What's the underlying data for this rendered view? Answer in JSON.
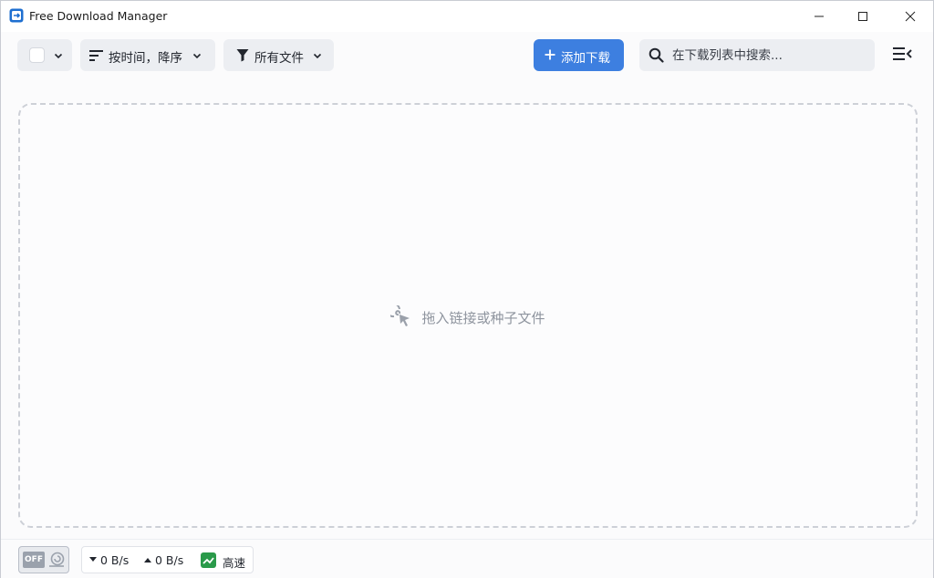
{
  "window": {
    "title": "Free Download Manager"
  },
  "toolbar": {
    "sort_label": "按时间，降序",
    "filter_label": "所有文件",
    "add_download_label": "添加下载",
    "search_placeholder": "在下载列表中搜索..."
  },
  "dropzone": {
    "hint": "拖入链接或种子文件"
  },
  "statusbar": {
    "turbo_state": "OFF",
    "download_speed": "0 B/s",
    "upload_speed": "0 B/s",
    "speed_mode": "高速"
  },
  "icons": {
    "app": "fdm-app-icon",
    "sort": "sort-lines-icon",
    "filter": "funnel-icon",
    "add": "plus-icon",
    "search": "search-icon",
    "menu": "menu-collapse-icon",
    "drop": "cursor-click-icon",
    "snail": "snail-icon",
    "speed_mode": "trend-up-icon"
  },
  "colors": {
    "accent": "#3d7fe0",
    "speed_mode_green": "#2a9a4a"
  }
}
